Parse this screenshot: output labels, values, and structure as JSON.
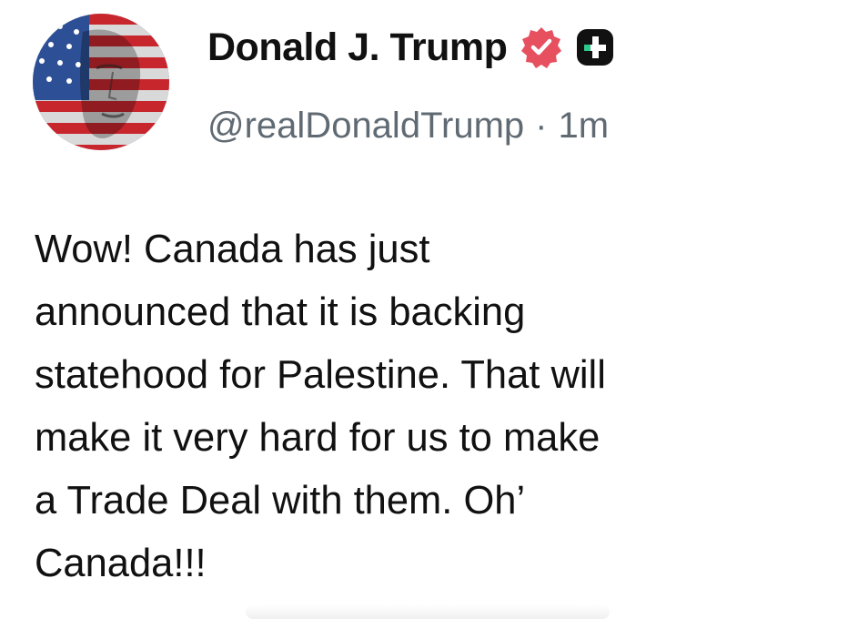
{
  "post": {
    "author": {
      "display_name": "Donald J. Trump",
      "handle": "@realDonaldTrump",
      "avatar": "avatar-flag-portrait"
    },
    "separator": "·",
    "timestamp": "1m",
    "icons": {
      "verified": "verified-badge-icon",
      "platform": "plus-square-icon"
    },
    "text": "Wow! Canada has just\nannounced that it is backing\nstatehood for Palestine. That will\nmake it very hard for us to make\na Trade Deal with them. Oh’\nCanada!!!"
  },
  "colors": {
    "verified_badge": "#e6505f",
    "platform_badge": "#111111",
    "text": "#111111",
    "meta": "#606a73"
  }
}
